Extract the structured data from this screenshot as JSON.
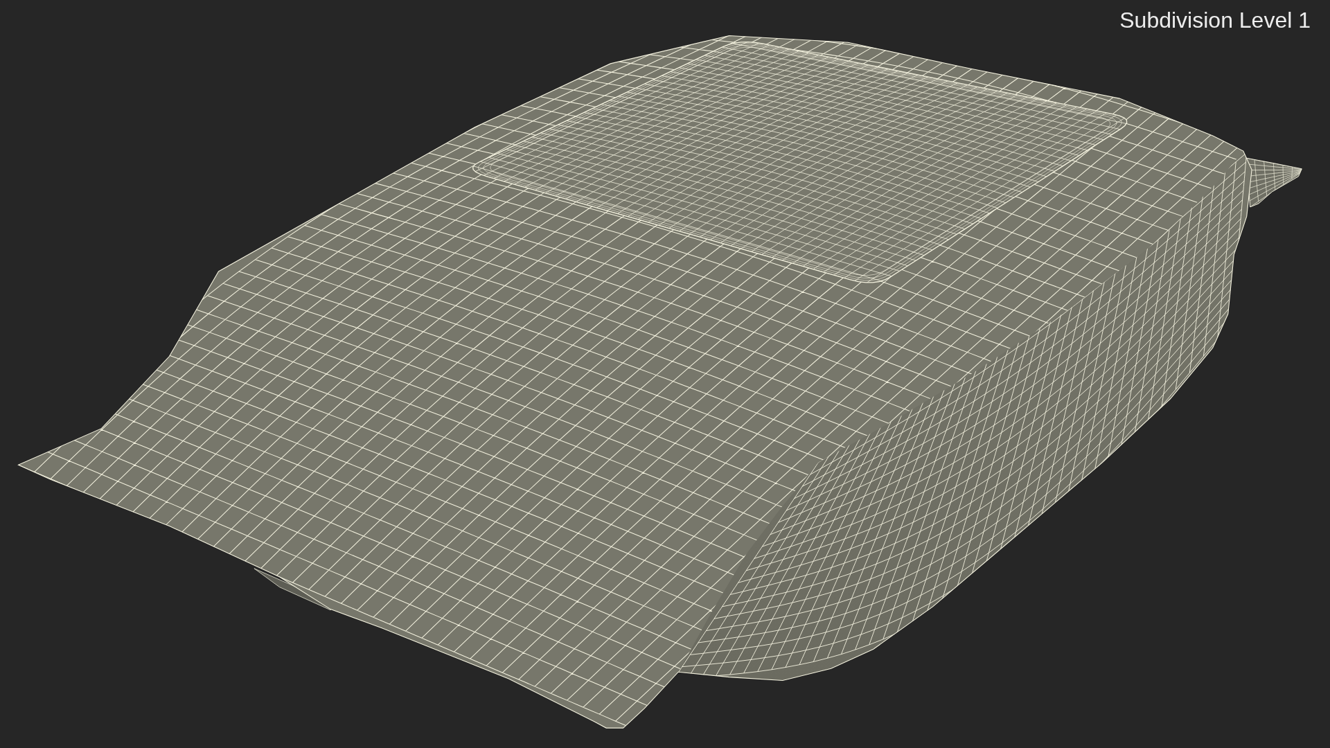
{
  "viewport": {
    "label": "Subdivision Level 1"
  }
}
